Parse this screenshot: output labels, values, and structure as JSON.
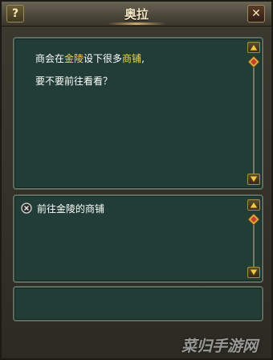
{
  "window": {
    "title": "奥拉",
    "help_label": "?",
    "close_label": "✕"
  },
  "dialog": {
    "line1_before": "商会在",
    "line1_place": "金陵",
    "line1_middle": "设下很多",
    "line1_shop": "商铺",
    "line1_after": ",",
    "line2": "要不要前往看看？"
  },
  "options": [
    {
      "label": "前往金陵的商铺"
    }
  ],
  "watermark": "菜归手游网",
  "colors": {
    "panel": "#213d36",
    "highlight": "#f4d35a",
    "text": "#ffffff"
  },
  "icons": {
    "help": "question-mark-icon",
    "close": "close-x-icon",
    "scroll_up": "triangle-up-icon",
    "scroll_down": "triangle-down-icon",
    "scroll_thumb": "diamond-icon",
    "option": "circled-x-icon"
  }
}
